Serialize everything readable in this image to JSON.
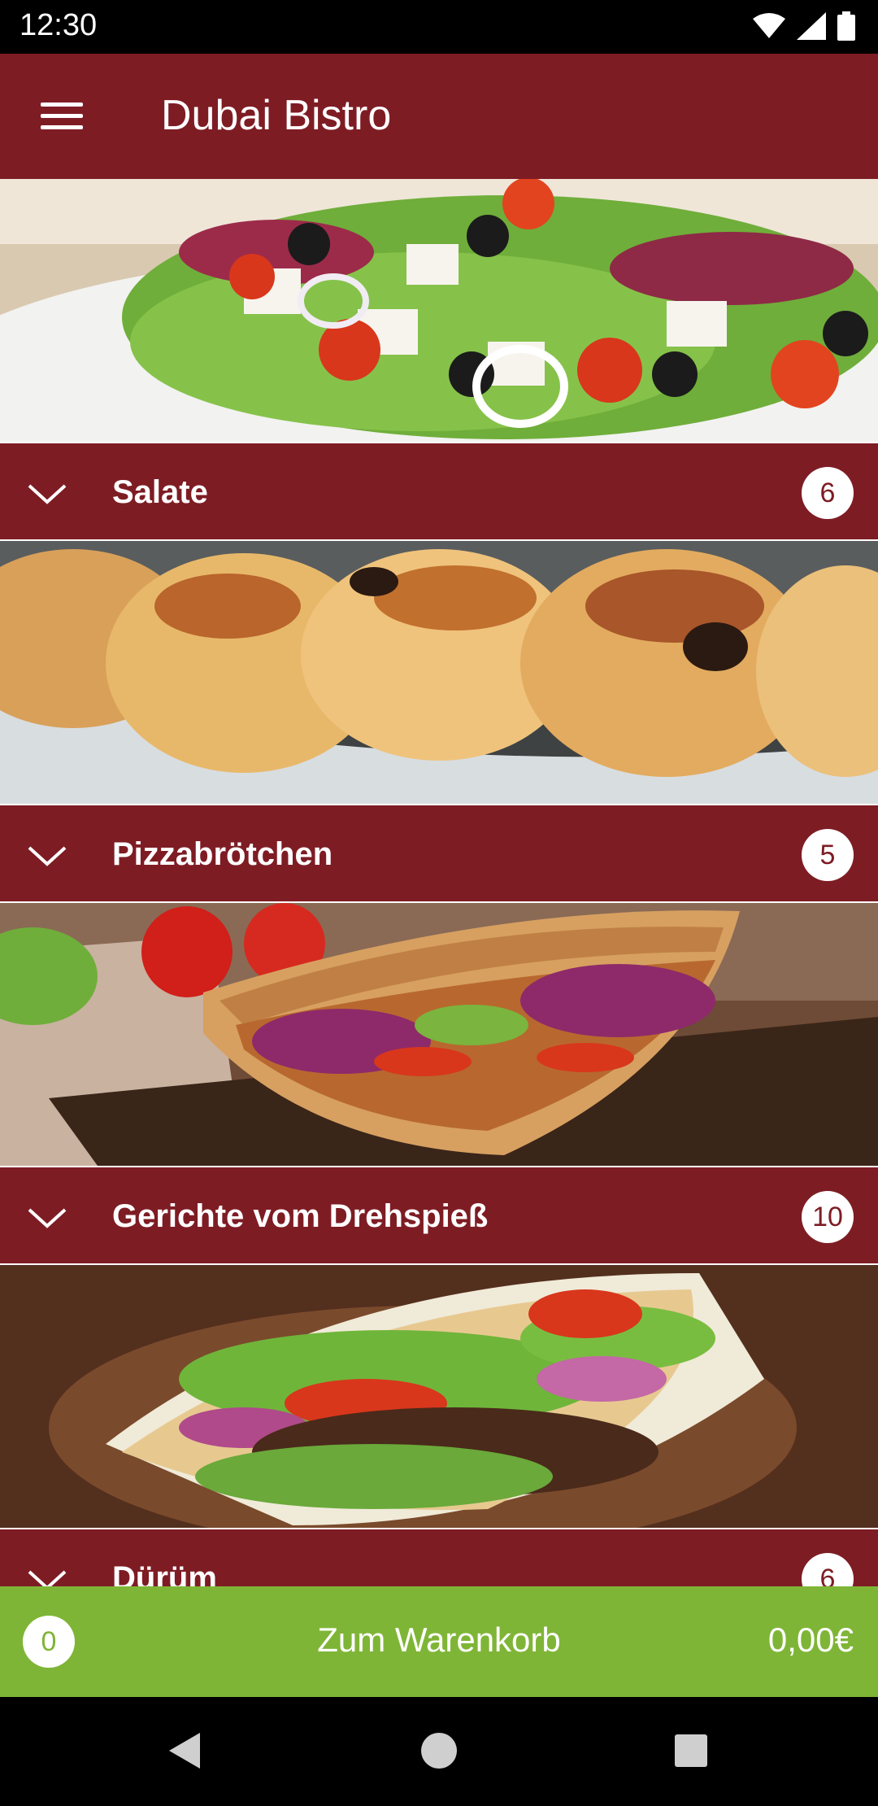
{
  "status": {
    "time": "12:30"
  },
  "app": {
    "title": "Dubai Bistro"
  },
  "icons": {
    "menu": "menu-icon",
    "chevron": "chevron-down-icon",
    "wifi": "wifi-icon",
    "signal": "cell-signal-icon",
    "battery": "battery-icon"
  },
  "colors": {
    "brand": "#7e1c24",
    "cart": "#7fb536"
  },
  "categories": [
    {
      "name": "Salate",
      "count": "6",
      "image": "greek salad with feta, olives, tomatoes and onions"
    },
    {
      "name": "Pizzabrötchen",
      "count": "5",
      "image": "baked pizza rolls on a plate"
    },
    {
      "name": "Gerichte vom Drehspieß",
      "count": "10",
      "image": "doner kebab in flatbread with red cabbage"
    },
    {
      "name": "Dürüm",
      "count": "6",
      "image": "flatbread with grilled meat, lettuce and tomato"
    }
  ],
  "cart": {
    "count": "0",
    "label": "Zum Warenkorb",
    "total": "0,00€"
  }
}
